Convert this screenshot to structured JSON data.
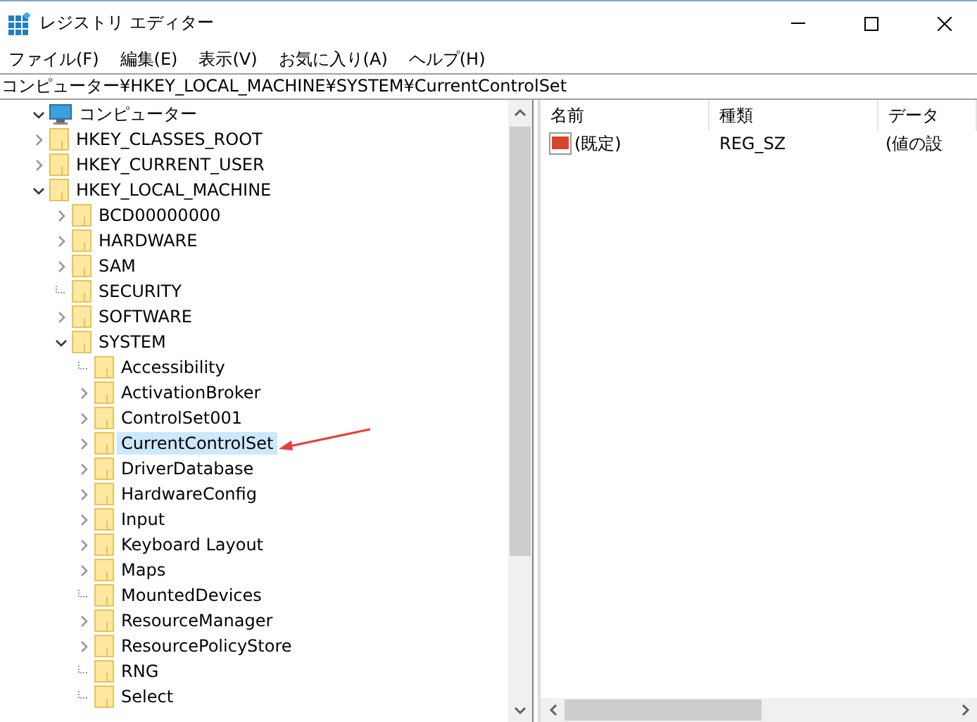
{
  "window": {
    "title": "レジストリ エディター"
  },
  "menu": [
    "ファイル(F)",
    "編集(E)",
    "表示(V)",
    "お気に入り(A)",
    "ヘルプ(H)"
  ],
  "address": "コンピューター¥HKEY_LOCAL_MACHINE¥SYSTEM¥CurrentControlSet",
  "tree": [
    {
      "label": "コンピューター",
      "kind": "computer",
      "expanded": true,
      "selected": false,
      "children": [
        {
          "label": "HKEY_CLASSES_ROOT",
          "kind": "branch",
          "expanded": false,
          "selected": false
        },
        {
          "label": "HKEY_CURRENT_USER",
          "kind": "branch",
          "expanded": false,
          "selected": false
        },
        {
          "label": "HKEY_LOCAL_MACHINE",
          "kind": "branch",
          "expanded": true,
          "selected": false,
          "children": [
            {
              "label": "BCD00000000",
              "kind": "branch",
              "expanded": false,
              "selected": false
            },
            {
              "label": "HARDWARE",
              "kind": "branch",
              "expanded": false,
              "selected": false
            },
            {
              "label": "SAM",
              "kind": "branch",
              "expanded": false,
              "selected": false
            },
            {
              "label": "SECURITY",
              "kind": "leaf",
              "selected": false
            },
            {
              "label": "SOFTWARE",
              "kind": "branch",
              "expanded": false,
              "selected": false
            },
            {
              "label": "SYSTEM",
              "kind": "branch",
              "expanded": true,
              "selected": false,
              "children": [
                {
                  "label": "Accessibility",
                  "kind": "leaf",
                  "selected": false
                },
                {
                  "label": "ActivationBroker",
                  "kind": "branch",
                  "expanded": false,
                  "selected": false
                },
                {
                  "label": "ControlSet001",
                  "kind": "branch",
                  "expanded": false,
                  "selected": false
                },
                {
                  "label": "CurrentControlSet",
                  "kind": "branch",
                  "expanded": false,
                  "selected": true
                },
                {
                  "label": "DriverDatabase",
                  "kind": "branch",
                  "expanded": false,
                  "selected": false
                },
                {
                  "label": "HardwareConfig",
                  "kind": "branch",
                  "expanded": false,
                  "selected": false
                },
                {
                  "label": "Input",
                  "kind": "branch",
                  "expanded": false,
                  "selected": false
                },
                {
                  "label": "Keyboard Layout",
                  "kind": "branch",
                  "expanded": false,
                  "selected": false
                },
                {
                  "label": "Maps",
                  "kind": "branch",
                  "expanded": false,
                  "selected": false
                },
                {
                  "label": "MountedDevices",
                  "kind": "leaf",
                  "selected": false
                },
                {
                  "label": "ResourceManager",
                  "kind": "branch",
                  "expanded": false,
                  "selected": false
                },
                {
                  "label": "ResourcePolicyStore",
                  "kind": "branch",
                  "expanded": false,
                  "selected": false
                },
                {
                  "label": "RNG",
                  "kind": "leaf",
                  "selected": false
                },
                {
                  "label": "Select",
                  "kind": "leaf",
                  "selected": false
                }
              ]
            }
          ]
        }
      ]
    }
  ],
  "list": {
    "columns": [
      "名前",
      "種類",
      "データ"
    ],
    "rows": [
      {
        "name": "(既定)",
        "type": "REG_SZ",
        "data": "(値の設"
      }
    ]
  }
}
